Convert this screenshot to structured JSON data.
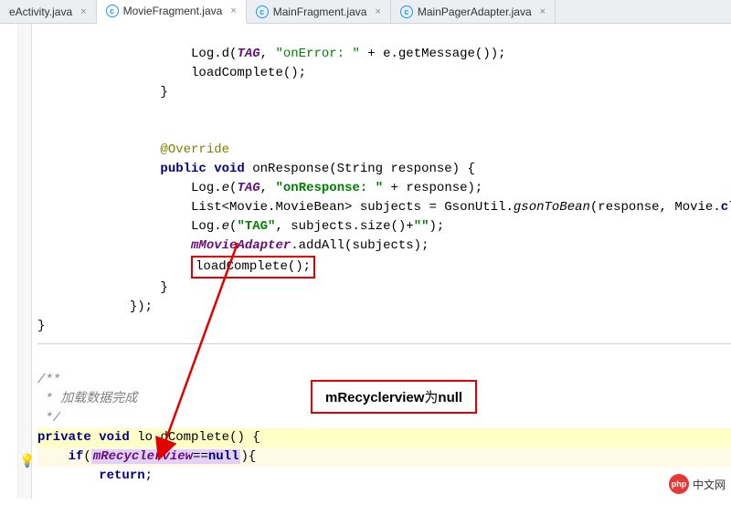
{
  "tabs": [
    {
      "label": "eActivity.java",
      "active": false
    },
    {
      "label": "MovieFragment.java",
      "active": true
    },
    {
      "label": "MainFragment.java",
      "active": false
    },
    {
      "label": "MainPagerAdapter.java",
      "active": false
    }
  ],
  "tab_close": "×",
  "tab_icon_letter": "c",
  "code": {
    "l1a": "                    Log.d(",
    "l1b": "TAG",
    "l1c": ", ",
    "l1d": "\"onError: \"",
    "l1e": " + e.getMessage());",
    "l2": "                    loadComplete();",
    "l3": "                }",
    "ann": "                @Override",
    "sig_a": "                ",
    "sig_kw1": "public void",
    "sig_name": " onResponse(String response) {",
    "log1_a": "                    Log.",
    "log1_e": "e",
    "log1_b": "(",
    "log1_tag": "TAG",
    "log1_c": ", ",
    "log1_str": "\"onResponse: \"",
    "log1_d": " + response);",
    "list_a": "                    List<Movie.MovieBean> subjects = GsonUtil.",
    "list_m": "gsonToBean",
    "list_b": "(response, Movie.",
    "list_c": "class",
    "list_d": ")",
    "log2_a": "                    Log.",
    "log2_e": "e",
    "log2_b": "(",
    "log2_str": "\"TAG\"",
    "log2_c": ", subjects.size()+",
    "log2_str2": "\"\"",
    "log2_d": ");",
    "add_a": "                    ",
    "add_f": "mMovieAdapter",
    "add_b": ".addAll(subjects);",
    "lc_box": "loadComplete();",
    "close1": "                }",
    "close2": "            });",
    "close3": "}",
    "comment1": "/**",
    "comment2": " * 加载数据完成",
    "comment3": " */",
    "priv_sig_a": "private void",
    "priv_sig_b": " lo",
    "priv_sig_c": "dComplete() {",
    "if_a": "    ",
    "if_kw": "if",
    "if_b": "(",
    "if_field": "mRecyclerview",
    "if_c": "==",
    "if_null": "null",
    "if_d": "){",
    "ret_a": "        ",
    "ret_kw": "return",
    "ret_b": ";"
  },
  "callout": {
    "text_a": "mRecyclerview",
    "text_b": "为",
    "text_c": "null"
  },
  "watermark": "中文网",
  "logo_text": "php"
}
